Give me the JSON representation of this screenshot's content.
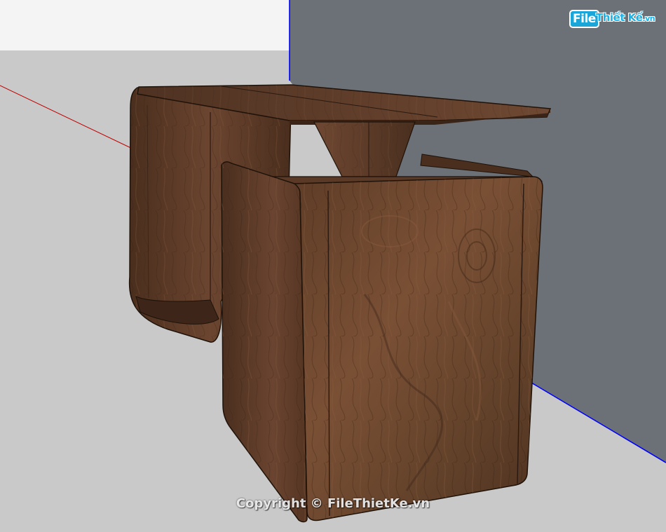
{
  "watermark": {
    "logo_file": "File",
    "logo_rest": "Thiết Kế",
    "logo_tld": ".vn",
    "copyright": "Copyright © FileThietKe.vn"
  },
  "scene": {
    "ground_color": "#c9c9c9",
    "sky_color": "#f4f4f4",
    "wall_color": "#6c7177",
    "wood_light": "#7a5237",
    "wood_mid": "#5b3a26",
    "wood_dark": "#3a2418",
    "axis_red": "#c00000",
    "axis_blue": "#0000ff"
  }
}
